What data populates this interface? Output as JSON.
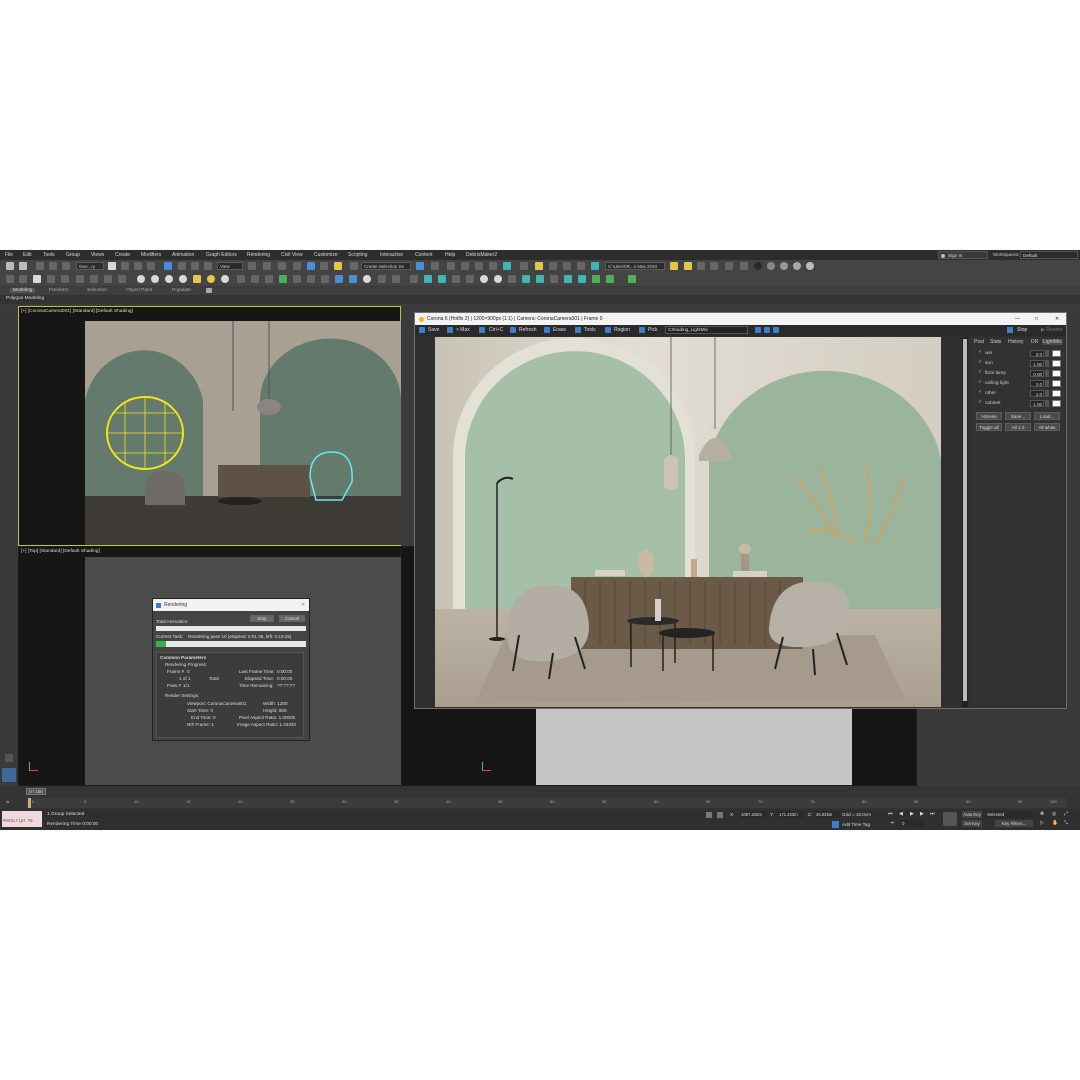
{
  "menubar": {
    "items": [
      "File",
      "Edit",
      "Tools",
      "Group",
      "Views",
      "Create",
      "Modifiers",
      "Animation",
      "Graph Editors",
      "Rendering",
      "Civil View",
      "Customize",
      "Scripting",
      "Interactive",
      "Content",
      "Help",
      "DebrisMaker2"
    ],
    "sign_in": "Sign In",
    "workspaces_label": "Workspaces:",
    "workspaces_value": "Default"
  },
  "toolbar": {
    "filter_select": "Geo...ry",
    "view_select": "View",
    "named_selection": "Create Selection Se",
    "project_path": "C:\\Users\\R...s Max 2020"
  },
  "ribbon": {
    "tabs": [
      "Modeling",
      "Freeform",
      "Selection",
      "Object Paint",
      "Populate"
    ],
    "sub_label": "Polygon Modeling"
  },
  "viewports": {
    "camera_label": "[+] [CoronaCamera001] [Standard] [Default Shading]",
    "top_label": "[+] [Top] [Standard] [Default Shading]"
  },
  "vfb": {
    "title": "Corona 6 (Hotfix 2) | 1200×900px (1:1) | Camera: CoronaCamera001 | Frame 0",
    "toolbar": [
      "Save",
      "> Max",
      "Ctrl+C",
      "Refresh",
      "Erase",
      "Tools",
      "Region",
      "Pick"
    ],
    "channel": "CShading_LightMix",
    "stop": "Stop",
    "render": "Render",
    "tabs": [
      "Post",
      "Stats",
      "History",
      "DR",
      "LightMix"
    ],
    "lightmix": [
      {
        "name": "win",
        "value": "2.0"
      },
      {
        "name": "sun",
        "value": "1.00"
      },
      {
        "name": "floor lamp",
        "value": "0.00"
      },
      {
        "name": "ceiling light",
        "value": "1.0"
      },
      {
        "name": "other",
        "value": "1.0"
      },
      {
        "name": "cabinet",
        "value": "1.00"
      }
    ],
    "buttons_row1": [
      ">Scene",
      "Save...",
      "Load..."
    ],
    "buttons_row2": [
      "Toggle all",
      "All 1.0",
      "All white"
    ]
  },
  "render_dialog": {
    "title": "Rendering",
    "stop": "Stop",
    "cancel": "Cancel",
    "total_animation": "Total Animation:",
    "current_task": "Current Task:",
    "current_task_value": "Rendering pass 10 (elapsed: 0:01:36, left: 0:19:35)",
    "section": "Common Parameters",
    "progress_label": "Rendering Progress:",
    "frame_label": "Frame #",
    "frame_value": "0",
    "of_value": "1 of 1",
    "total": "Total",
    "pass_label": "Pass #",
    "pass_value": "1/1",
    "last_frame": "Last Frame Time:",
    "last_frame_value": "0:00:00",
    "elapsed": "Elapsed Time:",
    "elapsed_value": "0:00:00",
    "remaining": "Time Remaining:",
    "remaining_value": "??:??:??",
    "settings": "Render Settings:",
    "viewport": "Viewport: CoronaCamera001",
    "width": "Width:  1200",
    "start": "Start Time: 0",
    "height": "Height:  900",
    "end": "End Time: 0",
    "pixel_aspect": "Pixel Aspect Ratio: 1.00000",
    "nth": "Nth Frame: 1",
    "image_aspect": "Image Aspect Ratio: 1.33333"
  },
  "timeline": {
    "counter": "0 / 100",
    "ticks": [
      "0",
      "5",
      "10",
      "15",
      "20",
      "25",
      "30",
      "35",
      "40",
      "45",
      "50",
      "55",
      "60",
      "65",
      "70",
      "75",
      "80",
      "85",
      "90",
      "95",
      "100"
    ]
  },
  "status": {
    "maxscript": "MAXScript Mi",
    "selection": "1 Group Selected",
    "render_time": "Rendering Time  0:00:00",
    "x": "1067.225m",
    "y": "171.223m",
    "z": "35.925m",
    "grid": "Grid = 10.0cm",
    "add_time_tag": "Add Time Tag",
    "auto_key": "Auto Key",
    "set_key": "Set Key",
    "selected": "Selected",
    "key_filters": "Key Filters...",
    "frame": "0"
  }
}
